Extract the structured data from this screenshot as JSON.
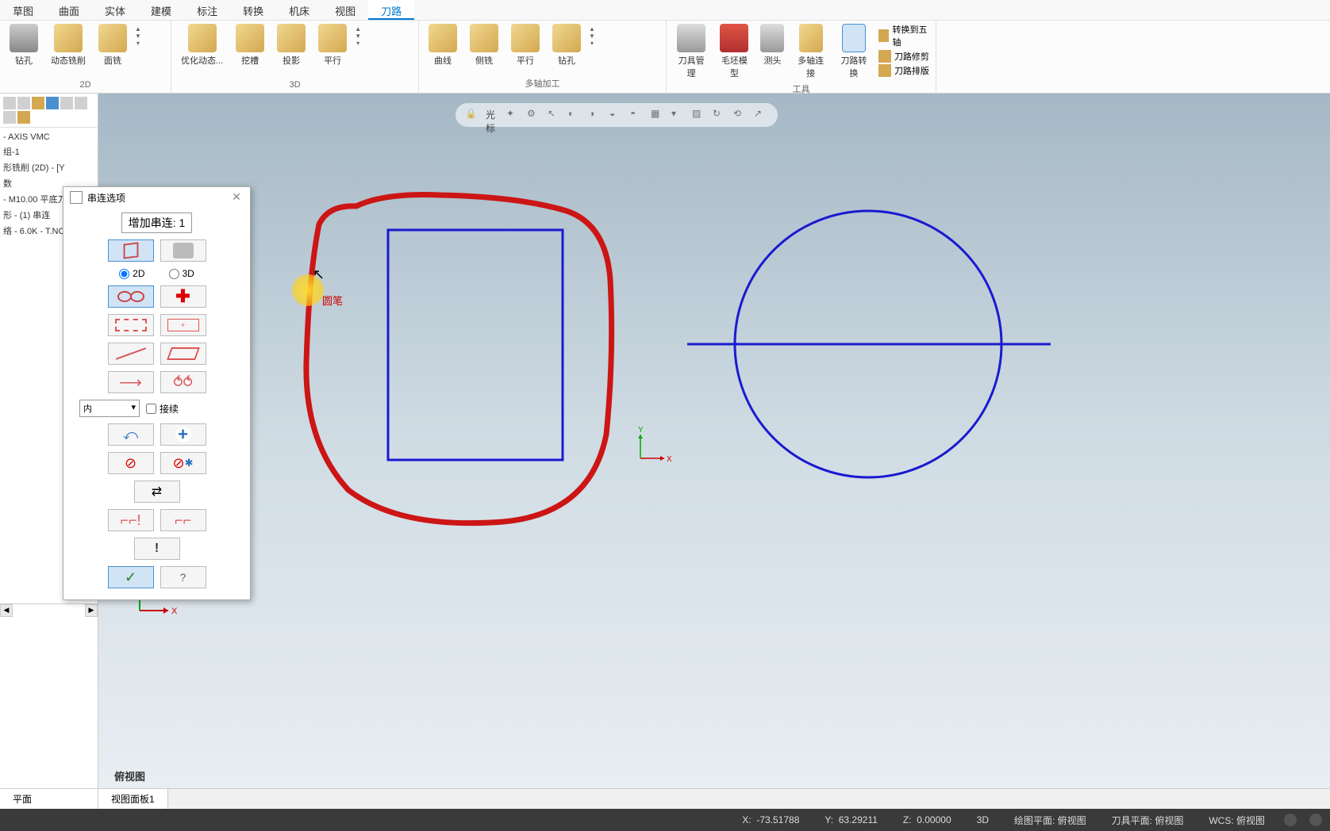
{
  "menu": {
    "tabs": [
      "草图",
      "曲面",
      "实体",
      "建模",
      "标注",
      "转换",
      "机床",
      "视图",
      "刀路"
    ],
    "active": "刀路"
  },
  "ribbon": {
    "group_2d": {
      "label": "2D",
      "buttons": [
        "钻孔",
        "动态铣削",
        "面铣"
      ]
    },
    "group_3d": {
      "label": "3D",
      "buttons": [
        "优化动态...",
        "挖槽",
        "投影",
        "平行"
      ]
    },
    "group_multi": {
      "label": "多轴加工",
      "buttons": [
        "曲线",
        "侧铣",
        "平行",
        "钻孔"
      ]
    },
    "group_tools": {
      "label": "工具",
      "buttons": [
        "刀具管理",
        "毛坯模型",
        "测头",
        "多轴连接",
        "刀路转换"
      ],
      "small": [
        "转换到五轴",
        "刀路修剪",
        "刀路排版"
      ]
    }
  },
  "tree": {
    "items": [
      "- AXIS VMC",
      "组-1",
      "形铣削 (2D) - [Y",
      "数",
      "- M10.00 平底刀",
      "形  - (1) 串连",
      "络 - 6.0K - T.NC"
    ]
  },
  "dialog": {
    "title": "串连选项",
    "counter": "增加串连: 1",
    "radio_2d": "2D",
    "radio_3d": "3D",
    "select_value": "内",
    "checkbox_label": "接续"
  },
  "canvas": {
    "cursor_label": "圆笔",
    "viewport_label": "俯视图",
    "axis_labels": {
      "x": "X",
      "y": "Y"
    }
  },
  "bottom": {
    "left_tabs": [
      "平面"
    ],
    "right_tabs": [
      "视图面板1"
    ]
  },
  "status": {
    "x_label": "X:",
    "x_value": "-73.51788",
    "y_label": "Y:",
    "y_value": "63.29211",
    "z_label": "Z:",
    "z_value": "0.00000",
    "mode": "3D",
    "drawing_plane": "绘图平面: 俯视图",
    "tool_plane": "刀具平面: 俯视图",
    "wcs": "WCS: 俯视图"
  }
}
